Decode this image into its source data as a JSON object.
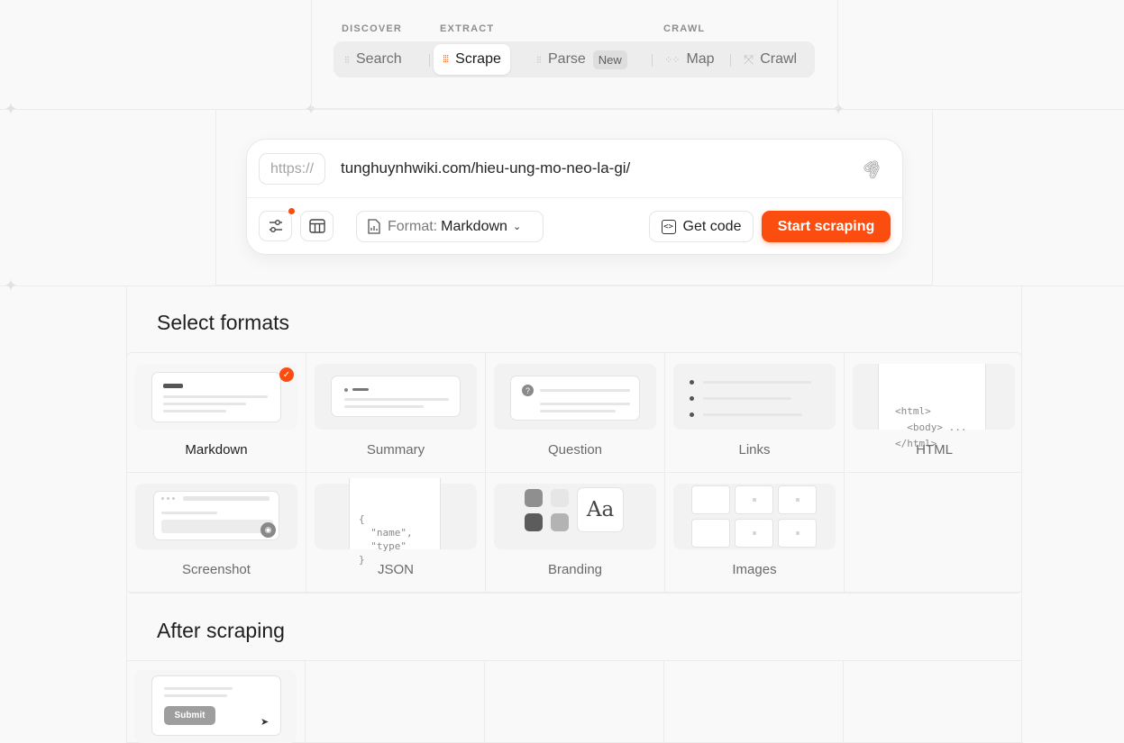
{
  "modes": {
    "categories": {
      "discover": "DISCOVER",
      "extract": "EXTRACT",
      "crawl": "CRAWL"
    },
    "items": [
      {
        "label": "Search"
      },
      {
        "label": "Scrape"
      },
      {
        "label": "Parse",
        "badge": "New"
      },
      {
        "label": "Map"
      },
      {
        "label": "Crawl"
      }
    ],
    "active": "Scrape"
  },
  "url_bar": {
    "protocol": "https://",
    "url": "tunghuynhwiki.com/hieu-ung-mo-neo-la-gi/",
    "format_label": "Format:",
    "format_value": "Markdown",
    "get_code_label": "Get code",
    "start_label": "Start scraping"
  },
  "select_formats": {
    "title": "Select formats",
    "items": [
      {
        "label": "Markdown",
        "selected": true
      },
      {
        "label": "Summary"
      },
      {
        "label": "Question"
      },
      {
        "label": "Links"
      },
      {
        "label": "HTML",
        "preview": [
          "<html>",
          "  <body> ...",
          "</html>"
        ]
      },
      {
        "label": "Screenshot"
      },
      {
        "label": "JSON",
        "preview": [
          "{",
          "  \"name\",",
          "  \"type\"",
          "}"
        ]
      },
      {
        "label": "Branding",
        "preview": "Aa"
      },
      {
        "label": "Images"
      }
    ]
  },
  "after_scraping": {
    "title": "After scraping",
    "submit_label": "Submit"
  },
  "colors": {
    "accent": "#fa4d0f",
    "background": "#f9f9f9"
  }
}
